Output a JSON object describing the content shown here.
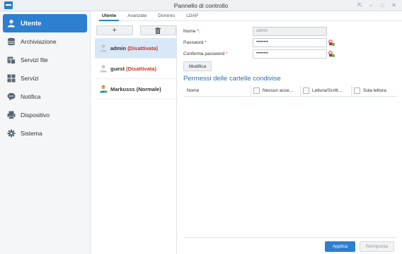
{
  "window": {
    "title": "Pannello di controllo",
    "controls": [
      "⇱",
      "–",
      "□",
      "✕"
    ]
  },
  "sidebar": {
    "items": [
      {
        "label": "Utente",
        "icon": "user-icon",
        "active": true
      },
      {
        "label": "Archiviazione",
        "icon": "storage-icon",
        "active": false
      },
      {
        "label": "Servizi file",
        "icon": "file-services-icon",
        "active": false
      },
      {
        "label": "Servizi",
        "icon": "services-icon",
        "active": false
      },
      {
        "label": "Notifica",
        "icon": "notification-icon",
        "active": false
      },
      {
        "label": "Dispositivo",
        "icon": "device-icon",
        "active": false
      },
      {
        "label": "Sistema",
        "icon": "system-icon",
        "active": false
      }
    ]
  },
  "tabs": [
    {
      "label": "Utente",
      "active": true
    },
    {
      "label": "Avanzate",
      "active": false
    },
    {
      "label": "Dominio",
      "active": false
    },
    {
      "label": "LDAP",
      "active": false
    }
  ],
  "users": {
    "add_label": "+",
    "items": [
      {
        "name": "admin",
        "status": "(Disattivata)",
        "selected": true
      },
      {
        "name": "guest",
        "status": "(Disattivata)",
        "selected": false
      },
      {
        "name": "Markusss",
        "status": "(Normale)",
        "selected": false
      }
    ]
  },
  "form": {
    "name_label": "Nome",
    "name_value": "admin",
    "password_label": "Password",
    "password_value": "••••••••",
    "confirm_label": "Conferma password",
    "confirm_value": "••••••••",
    "required_mark": "*",
    "name_suffix": ":",
    "modify_label": "Modifica"
  },
  "permissions": {
    "title": "Permessi delle cartelle condivise",
    "col_name": "Nome",
    "col_none": "Nessun acce...",
    "col_rw": "Lettura/Scritt...",
    "col_ro": "Sola lettura"
  },
  "footer": {
    "apply_label": "Applica",
    "reset_label": "Reimposta"
  },
  "colors": {
    "accent": "#2d7fcf",
    "disabled_status": "#c0392b"
  }
}
